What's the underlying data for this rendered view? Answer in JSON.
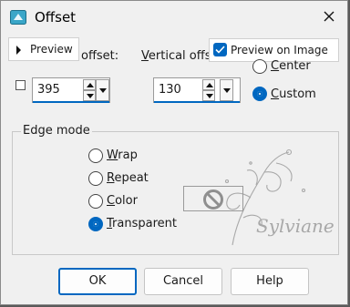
{
  "window": {
    "title": "Offset"
  },
  "preview": {
    "label": "Preview",
    "preview_on_image_label": "Preview on Image",
    "preview_on_image_checked": true
  },
  "offset": {
    "horizontal_label": "offset:",
    "vertical_label_underlined": "V",
    "vertical_label_rest": "ertical offse",
    "horizontal_value": "395",
    "vertical_value": "130"
  },
  "origin": {
    "options": [
      {
        "label_rest": "enter",
        "label_underlined": "C",
        "selected": false
      },
      {
        "label_rest": "ustom",
        "label_underlined": "C",
        "selected": true
      }
    ]
  },
  "edge_mode": {
    "title": "Edge mode",
    "options": [
      {
        "u": "W",
        "rest": "rap",
        "selected": false
      },
      {
        "u": "R",
        "rest": "epeat",
        "selected": false
      },
      {
        "u": "C",
        "rest": "olor",
        "selected": false
      },
      {
        "u": "T",
        "rest": "ransparent",
        "selected": true
      }
    ]
  },
  "watermark_text": "Sylviane",
  "buttons": {
    "ok": "OK",
    "cancel": "Cancel",
    "help": "Help"
  },
  "colors": {
    "accent": "#0067c0"
  }
}
